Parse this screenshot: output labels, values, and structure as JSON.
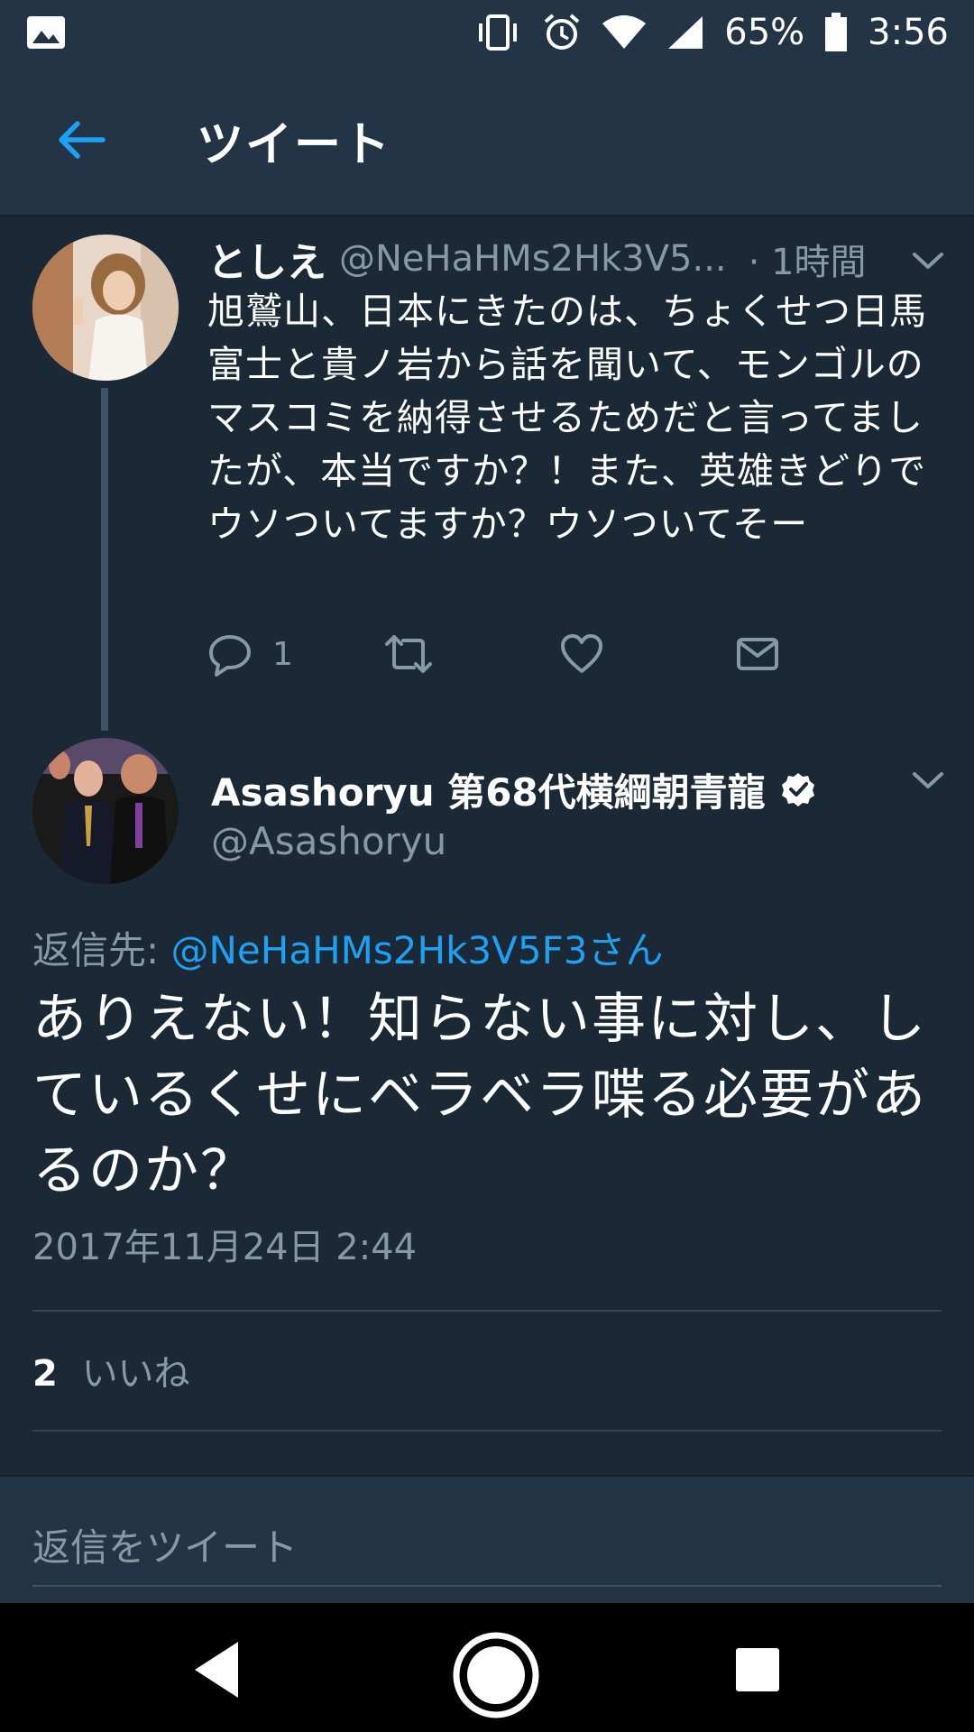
{
  "status_bar": {
    "battery_percent": "65%",
    "time": "3:56",
    "icons": [
      "gallery-icon",
      "vibrate-icon",
      "alarm-icon",
      "wifi-icon",
      "signal-icon",
      "battery-icon"
    ]
  },
  "app_bar": {
    "title": "ツイート",
    "back_icon": "back-arrow-icon"
  },
  "tweet_parent": {
    "name": "としえ",
    "handle": "@NeHaHMs2Hk3V5...",
    "time": "· 1時間",
    "text": "旭鷲山、日本にきたのは、ちょくせつ日馬富士と貴ノ岩から話を聞いて、モンゴルのマスコミを納得させるためだと言ってましたが、本当ですか？！また、英雄きどりでウソついてますか？ウソついてそー",
    "reply_count": "1"
  },
  "tweet_main": {
    "name": "Asashoryu 第68代横綱朝青龍",
    "verified": true,
    "handle": "@Asashoryu",
    "reply_to_label": "返信先:",
    "reply_to_mention": "@NeHaHMs2Hk3V5F3さん",
    "text": "ありえない！知らない事に対し、しているくせにベラベラ喋る必要があるのか？",
    "timestamp": "2017年11月24日 2:44",
    "likes_count": "2",
    "likes_label": "いいね"
  },
  "reply_bar": {
    "placeholder": "返信をツイート"
  },
  "colors": {
    "background": "#1b2836",
    "bar": "#243447",
    "accent": "#1da1f2",
    "secondary_text": "#8899a6"
  }
}
